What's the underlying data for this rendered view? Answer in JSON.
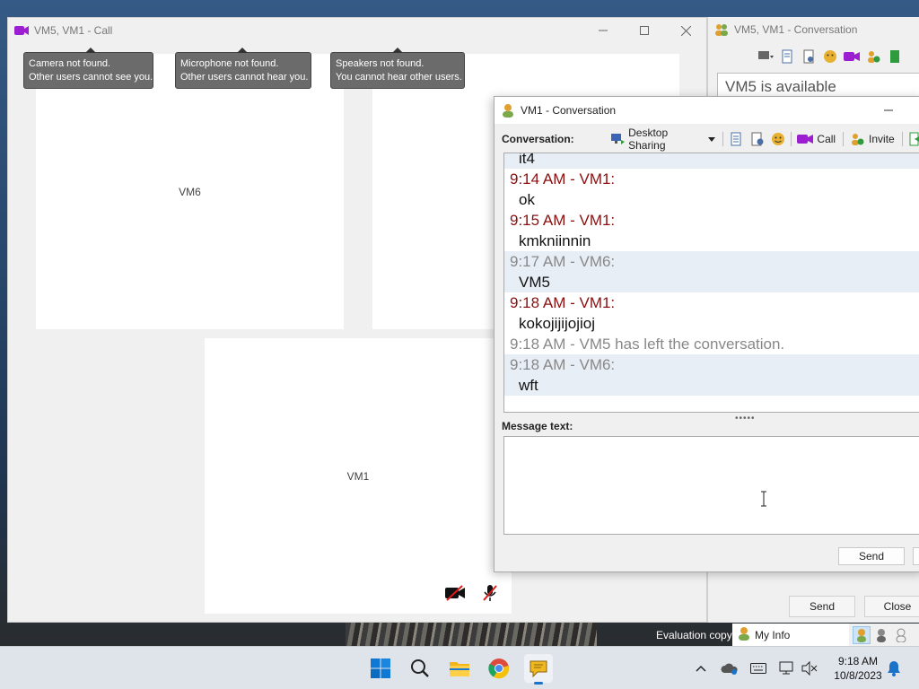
{
  "call_window": {
    "title": "VM5, VM1 - Call",
    "tooltips": [
      {
        "line1": "Camera not found.",
        "line2": "Other users cannot see you."
      },
      {
        "line1": "Microphone not found.",
        "line2": "Other users cannot hear you."
      },
      {
        "line1": "Speakers not found.",
        "line2": "You cannot hear other users."
      }
    ],
    "tiles": {
      "tile1": "VM6",
      "tile3": "VM1"
    }
  },
  "bg_conversation": {
    "title": "VM5, VM1 - Conversation",
    "status_text": "VM5 is available",
    "send_label": "Send",
    "close_label": "Close"
  },
  "conversation": {
    "title": "VM1 - Conversation",
    "label": "Conversation:",
    "desktop_sharing": "Desktop Sharing",
    "call": "Call",
    "invite": "Invite",
    "messages": [
      {
        "type": "body",
        "text": "it4",
        "shade": true
      },
      {
        "type": "vm1",
        "text": "9:14 AM - VM1:",
        "shade": false
      },
      {
        "type": "body",
        "text": "ok",
        "shade": false
      },
      {
        "type": "vm1",
        "text": "9:15 AM - VM1:",
        "shade": false
      },
      {
        "type": "body",
        "text": "kmkniinnin",
        "shade": false
      },
      {
        "type": "vm6",
        "text": "9:17 AM - VM6:",
        "shade": true
      },
      {
        "type": "body",
        "text": "VM5",
        "shade": true
      },
      {
        "type": "vm1",
        "text": "9:18 AM - VM1:",
        "shade": false
      },
      {
        "type": "body",
        "text": "kokojijijojioj",
        "shade": false
      },
      {
        "type": "sys",
        "text": "9:18 AM - VM5 has left the conversation.",
        "shade": false
      },
      {
        "type": "vm6",
        "text": "9:18 AM - VM6:",
        "shade": true
      },
      {
        "type": "body",
        "text": "wft",
        "shade": true
      }
    ],
    "message_label": "Message text:",
    "message_value": "",
    "send_label": "Send"
  },
  "bottom": {
    "eval_text": "Evaluation copy",
    "my_info": "My Info"
  },
  "taskbar": {
    "time": "9:18 AM",
    "date": "10/8/2023"
  },
  "colors": {
    "vm1_name": "#8a1010",
    "vm6_name": "#888888",
    "shade_row": "#e8eef6",
    "call_purple": "#9b1fd1",
    "taskbar_bg": "#dfe3ea"
  }
}
